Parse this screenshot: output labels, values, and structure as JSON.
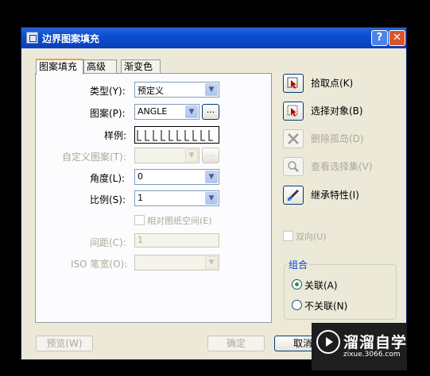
{
  "window": {
    "title": "边界图案填充",
    "help_label": "?",
    "close_label": "✕"
  },
  "tabs": [
    {
      "label": "图案填充",
      "active": true
    },
    {
      "label": "高级",
      "active": false
    },
    {
      "label": "渐变色",
      "active": false
    }
  ],
  "pattern_tab": {
    "type_label": "类型(Y):",
    "type_value": "预定义",
    "pattern_label": "图案(P):",
    "pattern_value": "ANGLE",
    "pattern_browse": "...",
    "swatch_label": "样例:",
    "custom_label": "自定义图案(T):",
    "custom_value": "",
    "custom_browse": "...",
    "angle_label": "角度(L):",
    "angle_value": "0",
    "scale_label": "比例(S):",
    "scale_value": "1",
    "relative_label": "相对图纸空间(E)",
    "spacing_label": "间距(C):",
    "spacing_value": "1",
    "iso_label": "ISO 笔宽(O):",
    "iso_value": ""
  },
  "side": {
    "pick_points": "拾取点(K)",
    "select_objects": "选择对象(B)",
    "remove_islands": "删除孤岛(D)",
    "view_selection": "查看选择集(V)",
    "inherit_props": "继承特性(I)",
    "double_label": "双向(U)"
  },
  "compose": {
    "title": "组合",
    "associative": "关联(A)",
    "nonassociative": "不关联(N)",
    "selected": "associative"
  },
  "footer": {
    "preview": "预览(W)",
    "ok": "确定",
    "cancel": "取消"
  },
  "watermark": {
    "title": "溜溜自学",
    "subtitle": "zixue.3066.com"
  }
}
